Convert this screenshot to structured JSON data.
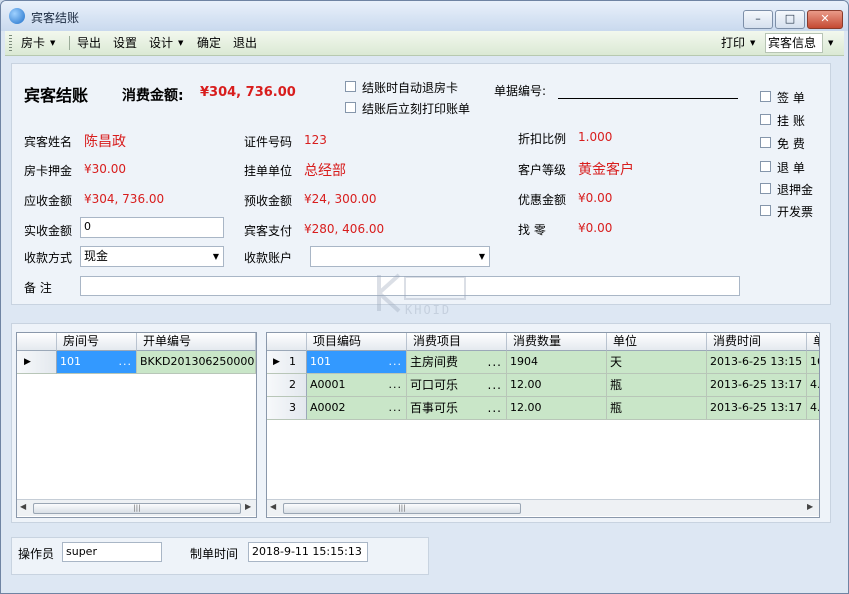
{
  "window": {
    "title": "宾客结账",
    "btn_min": "–",
    "btn_max": "□",
    "btn_close": "✕"
  },
  "toolbar": {
    "room_card": "房卡",
    "export": "导出",
    "settings": "设置",
    "design": "设计",
    "confirm": "确定",
    "exit": "退出",
    "print": "打印",
    "guest_info": "宾客信息",
    "dropdown_arrow": "▼"
  },
  "header": {
    "title": "宾客结账",
    "consumption_label": "消费金额:",
    "consumption_value": "¥304, 736.00",
    "auto_return_card": "结账时自动退房卡",
    "print_after_checkout": "结账后立刻打印账单",
    "doc_no_label": "单据编号:",
    "doc_no_value": ""
  },
  "form": {
    "guest_name_label": "宾客姓名",
    "guest_name": "陈昌政",
    "id_no_label": "证件号码",
    "id_no": "123",
    "discount_label": "折扣比例",
    "discount": "1.000",
    "deposit_label": "房卡押金",
    "deposit": "¥30.00",
    "unit_label": "挂单单位",
    "unit": "总经部",
    "level_label": "客户等级",
    "level": "黄金客户",
    "receivable_label": "应收金额",
    "receivable": "¥304, 736.00",
    "prepaid_label": "预收金额",
    "prepaid": "¥24, 300.00",
    "discount_amount_label": "优惠金额",
    "discount_amount": "¥0.00",
    "actual_label": "实收金额",
    "actual": "0",
    "guest_pay_label": "宾客支付",
    "guest_pay": "¥280, 406.00",
    "change_label": "找    零",
    "change": "¥0.00",
    "pay_method_label": "收款方式",
    "pay_method": "现金",
    "account_label": "收款账户",
    "account": "",
    "remark_label": "备    注",
    "remark": ""
  },
  "options": [
    {
      "label": "签    单"
    },
    {
      "label": "挂    账"
    },
    {
      "label": "免    费"
    },
    {
      "label": "退    单"
    },
    {
      "label": "退押金"
    },
    {
      "label": "开发票"
    }
  ],
  "room_grid": {
    "headers": [
      "房间号",
      "开单编号"
    ],
    "rows": [
      {
        "room": "101",
        "order": "BKKD201306250000..."
      }
    ]
  },
  "items_grid": {
    "headers": [
      "项目编码",
      "消费项目",
      "消费数量",
      "单位",
      "消费时间",
      "单"
    ],
    "rows": [
      {
        "no": "1",
        "code": "101",
        "item": "主房间费",
        "qty": "1904",
        "unit": "天",
        "time": "2013-6-25 13:15",
        "extra": "16"
      },
      {
        "no": "2",
        "code": "A0001",
        "item": "可口可乐",
        "qty": "12.00",
        "unit": "瓶",
        "time": "2013-6-25 13:17",
        "extra": "4."
      },
      {
        "no": "3",
        "code": "A0002",
        "item": "百事可乐",
        "qty": "12.00",
        "unit": "瓶",
        "time": "2013-6-25 13:17",
        "extra": "4."
      }
    ]
  },
  "footer": {
    "operator_label": "操作员",
    "operator": "super",
    "time_label": "制单时间",
    "time": "2018-9-11 15:15:13"
  },
  "watermark": {
    "text": "KHOID"
  },
  "colors": {
    "value_red": "#d81d1d",
    "selected_blue": "#3399ff",
    "row_green": "#c9e6c8"
  }
}
